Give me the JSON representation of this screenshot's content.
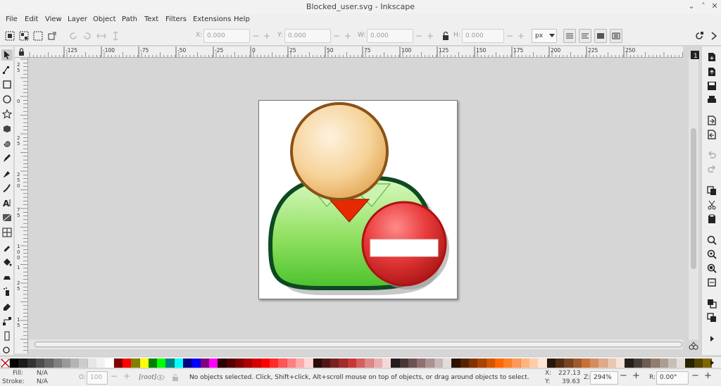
{
  "window": {
    "title": "Blocked_user.svg - Inkscape",
    "controls": {
      "minimize": "⌄",
      "maximize": "˄",
      "close": "✕"
    }
  },
  "menubar": {
    "items": [
      "File",
      "Edit",
      "View",
      "Layer",
      "Object",
      "Path",
      "Text",
      "Filters",
      "Extensions",
      "Help"
    ]
  },
  "tool_controls": {
    "x_label": "X:",
    "x_value": "0.000",
    "y_label": "Y:",
    "y_value": "0.000",
    "w_label": "W:",
    "w_value": "0.000",
    "h_label": "H:",
    "h_value": "0.000",
    "minus": "−",
    "plus": "+",
    "unit": "px"
  },
  "ruler": {
    "top_labels": [
      "-125",
      "-100",
      "-75",
      "-50",
      "-25",
      "0",
      "25",
      "50",
      "75",
      "100",
      "125",
      "150",
      "175",
      "200",
      "225",
      "250"
    ],
    "left_labels": [
      "2",
      "5",
      "0",
      "2",
      "5",
      "2",
      "5",
      "0",
      "7",
      "5",
      "1",
      "0",
      "0",
      "1",
      "2",
      "5",
      "1",
      "5"
    ]
  },
  "palette": {
    "colors": [
      "#000000",
      "#1a1a1a",
      "#333333",
      "#4d4d4d",
      "#666666",
      "#808080",
      "#999999",
      "#b3b3b3",
      "#cccccc",
      "#e6e6e6",
      "#f2f2f2",
      "#ffffff",
      "#800000",
      "#ff0000",
      "#808000",
      "#ffff00",
      "#008000",
      "#00ff00",
      "#008080",
      "#00ffff",
      "#000080",
      "#0000ff",
      "#800080",
      "#ff00ff",
      "#2b0000",
      "#550000",
      "#800000",
      "#aa0000",
      "#d40000",
      "#ff0000",
      "#ff2a2a",
      "#ff5555",
      "#ff8080",
      "#ffaaaa",
      "#ffd5d5",
      "#280b0b",
      "#501616",
      "#782121",
      "#a02c2c",
      "#c83737",
      "#d35f5f",
      "#de8787",
      "#e9afaf",
      "#f4d7d7",
      "#241c1c",
      "#483737",
      "#6c5353",
      "#916f6f",
      "#ac9393",
      "#c8b7b7",
      "#e3dbdb",
      "#2b1100",
      "#552200",
      "#803300",
      "#aa4400",
      "#d45500",
      "#ff6600",
      "#ff7f2a",
      "#ff9955",
      "#ffb380",
      "#ffccaa",
      "#ffe6d5",
      "#28170b",
      "#502d16",
      "#784421",
      "#a05a2c",
      "#c87137",
      "#d38d5f",
      "#deaa87",
      "#e9c6af",
      "#f4e3d7",
      "#241f1c",
      "#483e37",
      "#6c5d53",
      "#917c6f",
      "#ac9d93",
      "#c8beb7",
      "#e3dedb",
      "#2b2200",
      "#554400",
      "#806600"
    ]
  },
  "status": {
    "fill_label": "Fill:",
    "fill_value": "N/A",
    "stroke_label": "Stroke:",
    "stroke_value": "N/A",
    "opacity_label": "O:",
    "opacity_value": "100",
    "layer": "[root]",
    "message": "No objects selected. Click, Shift+click, Alt+scroll mouse on top of objects, or drag around objects to select.",
    "x_label": "X:",
    "x_value": "227.13",
    "y_label": "Y:",
    "y_value": "39.63",
    "zoom_label": "Z:",
    "zoom_value": "294%",
    "rotate_label": "R:",
    "rotate_value": "0.00°",
    "minus": "−",
    "plus": "+"
  },
  "colors": {
    "body_green_light": "#c8f5a8",
    "body_green": "#6fd24a",
    "body_outline": "#0f3f20",
    "head_light": "#fbe6c4",
    "head_dark": "#e8b56c",
    "head_outline": "#8a5a1c",
    "tie": "#e02000",
    "stop_red": "#e03030",
    "stop_dark": "#a01010"
  }
}
